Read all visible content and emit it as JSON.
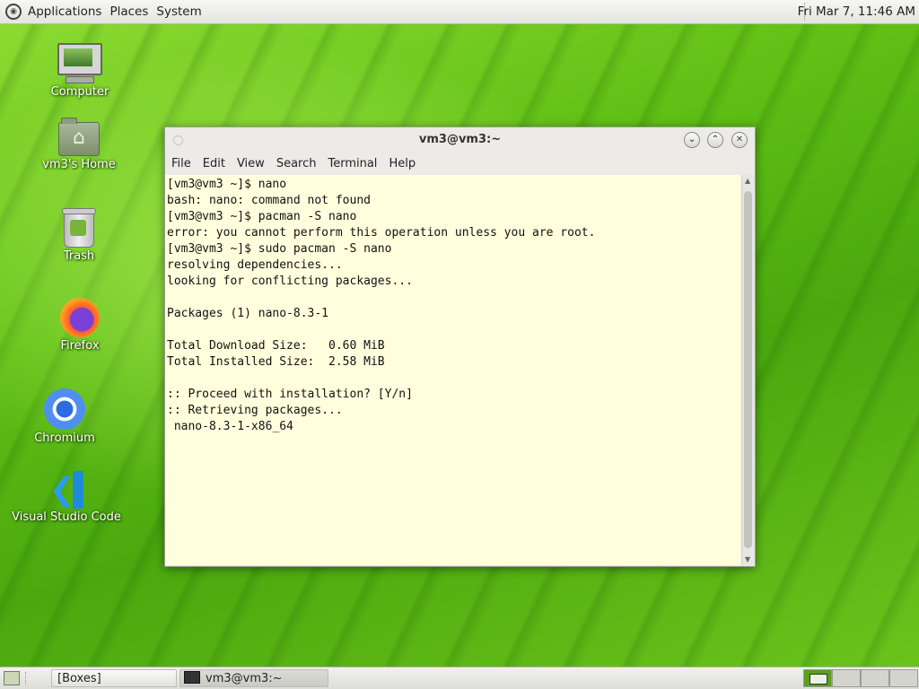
{
  "top_panel": {
    "menus": [
      "Applications",
      "Places",
      "System"
    ],
    "clock": "Fri Mar  7, 11:46 AM"
  },
  "desktop": {
    "icons": [
      {
        "label": "Computer",
        "icon": "computer-icon"
      },
      {
        "label": "vm3's Home",
        "icon": "home-folder-icon"
      },
      {
        "label": "Trash",
        "icon": "trash-icon"
      },
      {
        "label": "Firefox",
        "icon": "firefox-icon"
      },
      {
        "label": "Chromium",
        "icon": "chromium-icon"
      },
      {
        "label": "Visual Studio Code",
        "icon": "vscode-icon"
      }
    ]
  },
  "terminal": {
    "title": "vm3@vm3:~",
    "menu": [
      "File",
      "Edit",
      "View",
      "Search",
      "Terminal",
      "Help"
    ],
    "output": "[vm3@vm3 ~]$ nano\nbash: nano: command not found\n[vm3@vm3 ~]$ pacman -S nano\nerror: you cannot perform this operation unless you are root.\n[vm3@vm3 ~]$ sudo pacman -S nano\nresolving dependencies...\nlooking for conflicting packages...\n\nPackages (1) nano-8.3-1\n\nTotal Download Size:   0.60 MiB\nTotal Installed Size:  2.58 MiB\n\n:: Proceed with installation? [Y/n]\n:: Retrieving packages...\n nano-8.3-1-x86_64",
    "buttons": {
      "minimize": "⌄",
      "maximize": "⌃",
      "close": "✕"
    }
  },
  "taskbar": {
    "tasks": [
      "[Boxes]",
      "vm3@vm3:~"
    ],
    "workspaces": 4,
    "active_workspace": 1
  }
}
